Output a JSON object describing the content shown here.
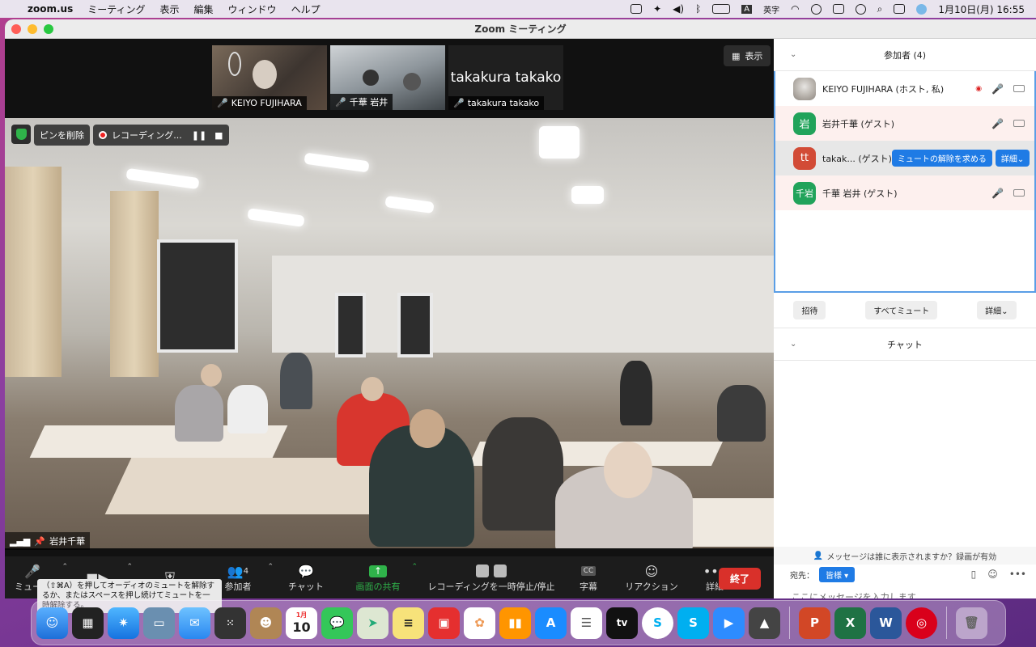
{
  "menubar": {
    "app": "zoom.us",
    "items": [
      "ミーティング",
      "表示",
      "編集",
      "ウィンドウ",
      "ヘルプ"
    ],
    "ime_letter": "A",
    "ime_label": "英字",
    "clock": "1月10日(月) 16:55"
  },
  "window": {
    "title": "Zoom ミーティング"
  },
  "thumbnails": [
    {
      "name": "KEIYO FUJIHARA"
    },
    {
      "name": "千華 岩井"
    },
    {
      "name": "takakura takako",
      "display_text": "takakura takako"
    }
  ],
  "view_button": "表示",
  "video_controls": {
    "unpin": "ピンを削除",
    "recording": "レコーディング..."
  },
  "active_speaker": "岩井千華",
  "toolbar": {
    "mute": "ミュート",
    "participants_count": "4",
    "participants": "参加者",
    "chat": "チャット",
    "share": "画面の共有",
    "record_pause": "レコーディングを一時停止/停止",
    "cc_icon": "CC",
    "captions": "字幕",
    "reactions": "リアクション",
    "more": "詳細",
    "end": "終了"
  },
  "tooltip": "（⇧⌘A）を押してオーディオのミュートを解除するか、またはスペースを押し続けてミュートを一時解除する。",
  "participants_panel": {
    "title": "参加者 (4)",
    "list": [
      {
        "avatar": "",
        "name": "KEIYO FUJIHARA (ホスト, 私)"
      },
      {
        "avatar": "岩",
        "name": "岩井千華 (ゲスト)"
      },
      {
        "avatar": "tt",
        "name": "takak... (ゲスト)",
        "ask_unmute": "ミュートの解除を求める",
        "more": "詳細"
      },
      {
        "avatar": "千岩",
        "name": "千華 岩井 (ゲスト)"
      }
    ],
    "invite": "招待",
    "mute_all": "すべてミュート",
    "more": "詳細"
  },
  "chat_panel": {
    "title": "チャット",
    "notice": "メッセージは誰に表示されますか？録画が有効",
    "to_label": "宛先：",
    "to_value": "皆様",
    "placeholder": "ここにメッセージを入力します..."
  },
  "dock": {
    "calendar_month": "1月",
    "calendar_day": "10",
    "tv_label": "tv"
  },
  "colors": {
    "accent_blue": "#1f7be5",
    "share_green": "#2fb34a",
    "end_red": "#d9302a",
    "avatar_green": "#21a35a",
    "avatar_red": "#d24b36"
  }
}
